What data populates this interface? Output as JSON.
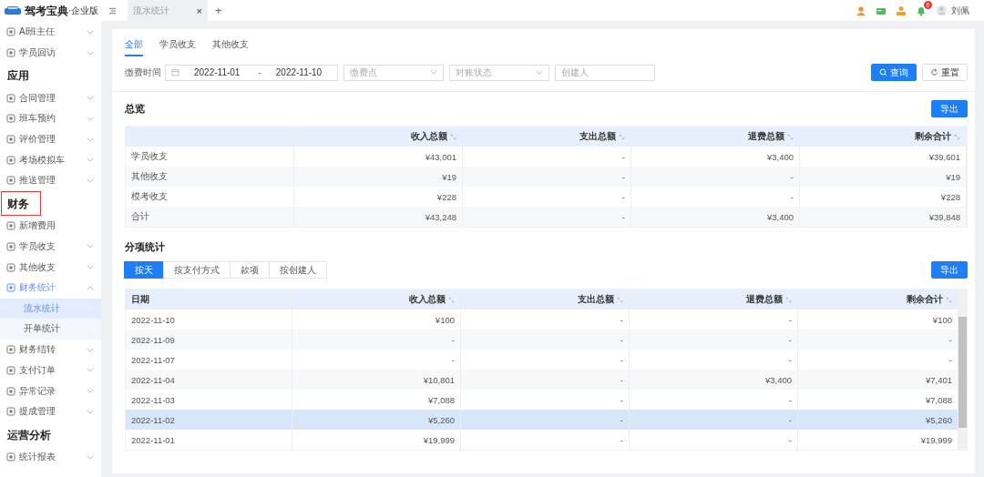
{
  "logo": {
    "name": "驾考宝典",
    "edition": "·企业版"
  },
  "sidebar": {
    "entries": [
      {
        "kind": "item",
        "label": "AI班主任",
        "expanded": false,
        "active": false
      },
      {
        "kind": "item",
        "label": "学员回访",
        "expanded": false,
        "active": false
      },
      {
        "kind": "group",
        "label": "应用",
        "highlighted": false
      },
      {
        "kind": "item",
        "label": "合同管理",
        "expanded": false,
        "active": false
      },
      {
        "kind": "item",
        "label": "班车预约",
        "expanded": false,
        "active": false
      },
      {
        "kind": "item",
        "label": "评价管理",
        "expanded": false,
        "active": false
      },
      {
        "kind": "item",
        "label": "考场模拟车",
        "expanded": false,
        "active": false
      },
      {
        "kind": "item",
        "label": "推送管理",
        "expanded": false,
        "active": false
      },
      {
        "kind": "group",
        "label": "财务",
        "highlighted": true
      },
      {
        "kind": "link",
        "label": "新增费用",
        "active": false
      },
      {
        "kind": "item",
        "label": "学员收支",
        "expanded": false,
        "active": false
      },
      {
        "kind": "item",
        "label": "其他收支",
        "expanded": false,
        "active": false
      },
      {
        "kind": "item",
        "label": "财务统计",
        "expanded": true,
        "active": true,
        "children": [
          {
            "label": "流水统计",
            "selected": true
          },
          {
            "label": "开单统计",
            "selected": false
          }
        ]
      },
      {
        "kind": "item",
        "label": "财务结转",
        "expanded": false,
        "active": false
      },
      {
        "kind": "item",
        "label": "支付订单",
        "expanded": false,
        "active": false
      },
      {
        "kind": "item",
        "label": "异常记录",
        "expanded": false,
        "active": false
      },
      {
        "kind": "item",
        "label": "提成管理",
        "expanded": false,
        "active": false
      },
      {
        "kind": "group",
        "label": "运营分析",
        "highlighted": false
      },
      {
        "kind": "item",
        "label": "统计报表",
        "expanded": false,
        "active": false
      }
    ]
  },
  "topbar": {
    "tabs": [
      {
        "label": "流水统计",
        "selected": true,
        "close": "×"
      }
    ],
    "add": "+",
    "notification_count": "6",
    "user": "刘佩"
  },
  "main": {
    "tabs": [
      {
        "label": "全部",
        "selected": true
      },
      {
        "label": "学员收支",
        "selected": false
      },
      {
        "label": "其他收支",
        "selected": false
      }
    ],
    "filter": {
      "label": "缴费时间",
      "start": "2022-11-01",
      "separator": "-",
      "end": "2022-11-10",
      "fields": [
        {
          "kind": "select",
          "placeholder": "缴费点"
        },
        {
          "kind": "select",
          "placeholder": "对账状态"
        },
        {
          "kind": "input",
          "placeholder": "创建人"
        }
      ],
      "buttons": [
        {
          "kind": "primary",
          "label": "查询"
        },
        {
          "kind": "default",
          "label": "重置"
        }
      ]
    },
    "overview": {
      "title": "总览",
      "export": "导出",
      "columns": [
        {
          "label": "收入总额",
          "sortable": true
        },
        {
          "label": "支出总额",
          "sortable": true
        },
        {
          "label": "退费总额",
          "sortable": true
        },
        {
          "label": "剩余合计",
          "sortable": true
        }
      ],
      "rows": [
        {
          "label": "学员收支",
          "cells": [
            "¥43,001",
            "-",
            "¥3,400",
            "¥39,601"
          ]
        },
        {
          "label": "其他收支",
          "cells": [
            "¥19",
            "-",
            "-",
            "¥19"
          ]
        },
        {
          "label": "模考收支",
          "cells": [
            "¥228",
            "-",
            "-",
            "¥228"
          ]
        },
        {
          "label": "合计",
          "cells": [
            "¥43,248",
            "-",
            "¥3,400",
            "¥39,848"
          ]
        }
      ]
    },
    "breakdown": {
      "title": "分项统计",
      "export": "导出",
      "segments": [
        {
          "label": "按天",
          "selected": true
        },
        {
          "label": "按支付方式",
          "selected": false
        },
        {
          "label": "款项",
          "selected": false
        },
        {
          "label": "按创建人",
          "selected": false
        }
      ],
      "columns": [
        {
          "label": "日期",
          "sortable": false
        },
        {
          "label": "收入总额",
          "sortable": true
        },
        {
          "label": "支出总额",
          "sortable": true
        },
        {
          "label": "退费总额",
          "sortable": true
        },
        {
          "label": "剩余合计",
          "sortable": true
        }
      ],
      "rows": [
        {
          "selected": false,
          "cells": [
            "2022-11-10",
            "¥100",
            "-",
            "-",
            "¥100"
          ]
        },
        {
          "selected": false,
          "cells": [
            "2022-11-09",
            "-",
            "-",
            "-",
            "-"
          ]
        },
        {
          "selected": false,
          "cells": [
            "2022-11-07",
            "-",
            "-",
            "-",
            "-"
          ]
        },
        {
          "selected": false,
          "cells": [
            "2022-11-04",
            "¥10,801",
            "-",
            "¥3,400",
            "¥7,401"
          ]
        },
        {
          "selected": false,
          "cells": [
            "2022-11-03",
            "¥7,088",
            "-",
            "-",
            "¥7,088"
          ]
        },
        {
          "selected": true,
          "cells": [
            "2022-11-02",
            "¥5,260",
            "-",
            "-",
            "¥5,260"
          ]
        },
        {
          "selected": false,
          "cells": [
            "2022-11-01",
            "¥19,999",
            "-",
            "-",
            "¥19,999"
          ]
        }
      ]
    }
  }
}
